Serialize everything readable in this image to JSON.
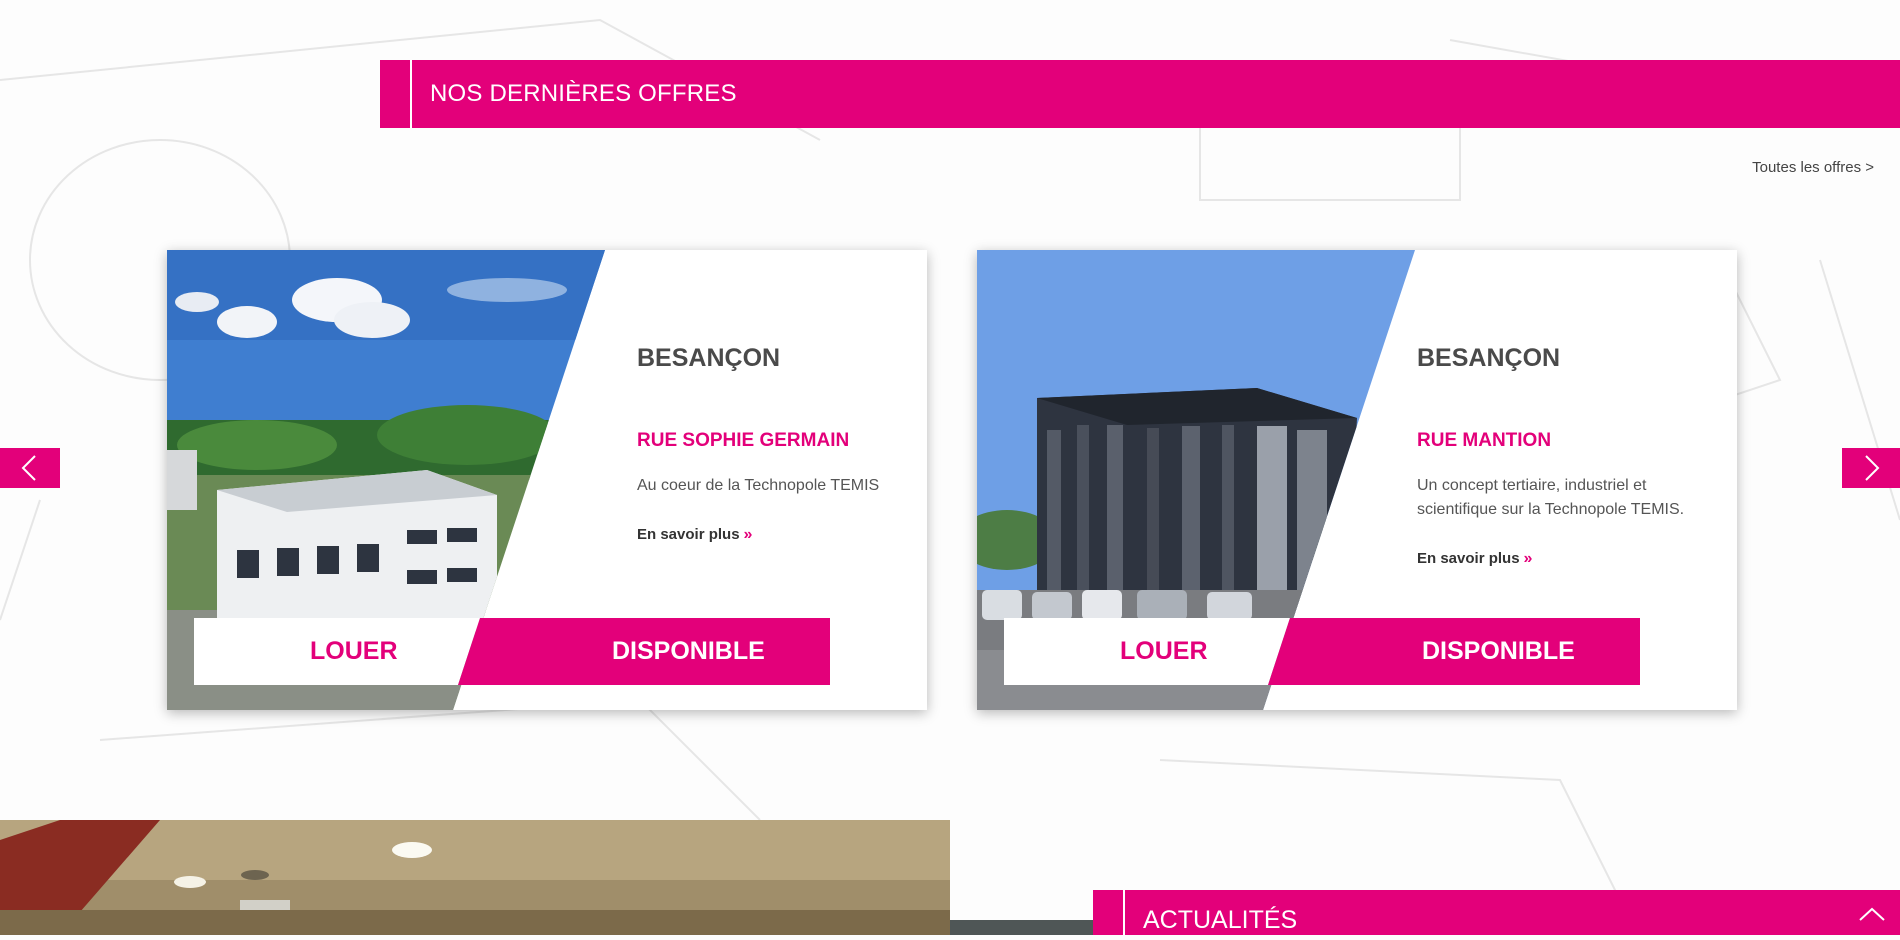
{
  "section": {
    "title": "NOS DERNIÈRES OFFRES",
    "all_offers": "Toutes les offres >"
  },
  "offers": [
    {
      "city": "BESANÇON",
      "street": "RUE SOPHIE GERMAIN",
      "description": "Au coeur de la Technopole TEMIS",
      "more": "En savoir plus",
      "type": "LOUER",
      "status": "DISPONIBLE"
    },
    {
      "city": "BESANÇON",
      "street": "RUE MANTION",
      "description": "Un concept tertiaire, industriel et scientifique sur la Technopole TEMIS.",
      "more": "En savoir plus",
      "type": "LOUER",
      "status": "DISPONIBLE"
    }
  ],
  "carousel": {
    "prev_icon": "chevron-left-icon",
    "next_icon": "chevron-right-icon"
  },
  "news": {
    "title": "ACTUALITÉS",
    "scroll_icon": "chevron-up-icon"
  },
  "colors": {
    "accent": "#e3007a",
    "text_dark": "#4a4a4a"
  }
}
